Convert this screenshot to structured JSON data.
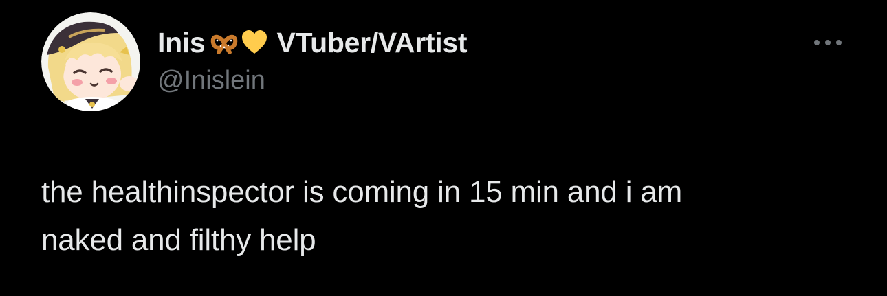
{
  "tweet": {
    "author": {
      "display_name": "Inis",
      "name_emojis": [
        "pretzel-emoji",
        "yellow-heart-emoji"
      ],
      "name_suffix": "VTuber/VArtist",
      "handle": "@Inislein",
      "avatar_icon": "anime-avatar"
    },
    "more_icon": "more-options-icon",
    "text_lines": [
      "the healthinspector is coming in 15 min and i am",
      "naked and filthy help"
    ]
  },
  "colors": {
    "background": "#000000",
    "primary_text": "#e7e9ea",
    "secondary_text": "#71767b",
    "heart": "#ffcc4d",
    "pretzel": "#d4893a"
  }
}
